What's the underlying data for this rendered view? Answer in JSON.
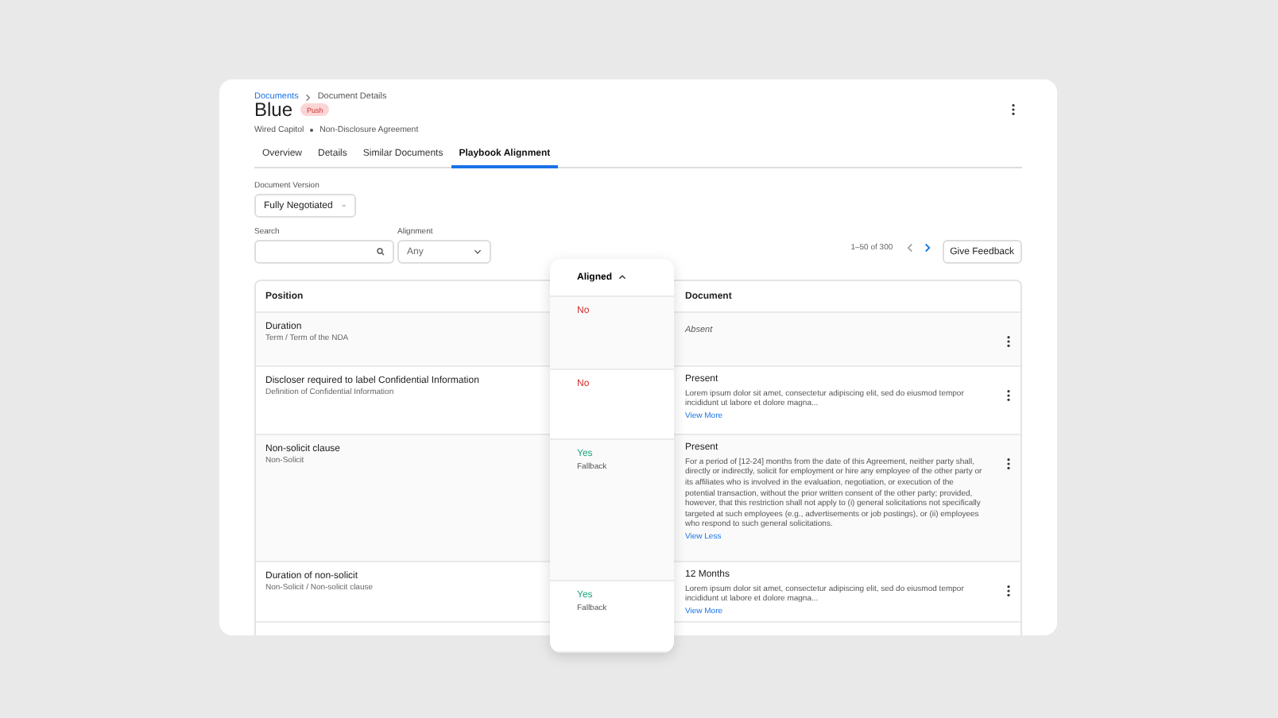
{
  "breadcrumb": [
    {
      "label": "Documents",
      "link": true
    },
    {
      "label": "Document Details",
      "link": false
    }
  ],
  "title": "Blue",
  "badge": "Push",
  "subtitle": [
    "Wired Capitol",
    "Non-Disclosure Agreement"
  ],
  "tabs": [
    {
      "label": "Overview",
      "selected": false
    },
    {
      "label": "Details",
      "selected": false
    },
    {
      "label": "Similar Documents",
      "selected": false
    },
    {
      "label": "Playbook Alignment",
      "selected": true
    }
  ],
  "version": {
    "label": "Document Version",
    "value": "Fully Negotiated"
  },
  "search": {
    "label": "Search"
  },
  "alignment_filter": {
    "label": "Alignment",
    "value": "Any"
  },
  "pagination": {
    "range": "1–50 of 300",
    "prev_disabled": true,
    "next_disabled": false
  },
  "feedback_button": "Give Feedback",
  "table": {
    "columns": [
      "Position",
      "Aligned",
      "Document"
    ],
    "rows": [
      {
        "position": "Duration",
        "path": "Term / Term of the NDA",
        "aligned": false,
        "aligned_label": "No",
        "doc_absent": true,
        "doc_status": "Absent"
      },
      {
        "position": "Discloser required to label Confidential Information",
        "path": "Definition of Confidential Information",
        "aligned": false,
        "aligned_label": "No",
        "doc_absent": false,
        "doc_status": "Present",
        "doc_text": "Lorem ipsum dolor sit amet, consectetur adipiscing elit, sed do eiusmod tempor incididunt ut labore et dolore magna...",
        "doc_link": "View More"
      },
      {
        "position": "Non-solicit clause",
        "path": "Non-Solicit",
        "aligned": true,
        "aligned_label": "Yes",
        "aligned_note": "Fallback",
        "doc_absent": false,
        "doc_status": "Present",
        "doc_text": "For a period of [12-24] months from the date of this Agreement, neither party shall, directly or indirectly, solicit for employment or hire any employee of the other party or its affiliates who is involved in the evaluation, negotiation, or execution of the potential transaction, without the prior written consent of the other party; provided, however, that this restriction shall not apply to (i) general solicitations not specifically targeted at such employees (e.g., advertisements or job postings), or (ii) employees who respond to such general solicitations.",
        "doc_link": "View Less"
      },
      {
        "position": "Duration of non-solicit",
        "path": "Non-Solicit / Non-solicit clause",
        "aligned": true,
        "aligned_label": "Yes",
        "aligned_note": "Fallback",
        "doc_absent": false,
        "doc_status": "12 Months",
        "doc_text": "Lorem ipsum dolor sit amet, consectetur adipiscing elit, sed do eiusmod tempor incididunt ut labore et dolore magna...",
        "doc_link": "View More"
      }
    ]
  }
}
